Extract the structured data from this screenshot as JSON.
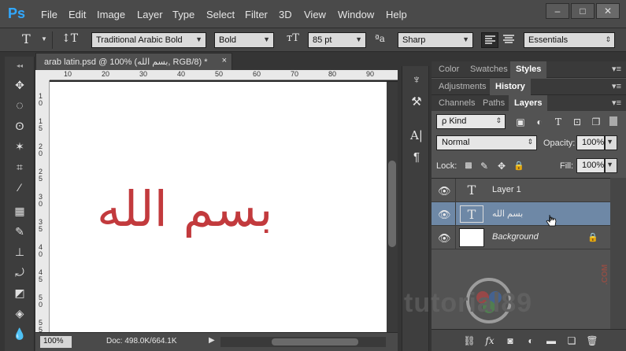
{
  "app": {
    "logo": "Ps"
  },
  "menu": [
    "File",
    "Edit",
    "Image",
    "Layer",
    "Type",
    "Select",
    "Filter",
    "3D",
    "View",
    "Window",
    "Help"
  ],
  "window_controls": {
    "minimize": "–",
    "maximize": "□",
    "close": "✕"
  },
  "options_bar": {
    "tool_glyph": "T",
    "orientation_glyph": "↕T",
    "font_family": "Traditional Arabic Bold",
    "font_style": "Bold",
    "size_glyph": "тT",
    "font_size": "85 pt",
    "aa_glyph": "ªa",
    "anti_alias": "Sharp",
    "workspace": "Essentials"
  },
  "document": {
    "tab_title": "arab latin.psd @ 100% (بسم الله, RGB/8) *",
    "tab_close": "×",
    "canvas_text": "بسم الله",
    "text_color": "#c23a3d",
    "ruler_top": [
      "10",
      "20",
      "30",
      "40",
      "50",
      "60",
      "70",
      "80",
      "90"
    ],
    "ruler_left": [
      "1\n0",
      "1\n5",
      "2\n0",
      "2\n5",
      "3\n0",
      "3\n5",
      "4\n0",
      "4\n5",
      "5\n0",
      "5\n5"
    ]
  },
  "status": {
    "zoom": "100%",
    "doc_info": "Doc: 498.0K/664.1K",
    "arrow": "▶"
  },
  "panels": {
    "row1_tabs": [
      "Color",
      "Swatches",
      "Styles"
    ],
    "row1_active": "Styles",
    "row2_tabs": [
      "Adjustments",
      "History"
    ],
    "row2_active": "History",
    "row3_tabs": [
      "Channels",
      "Paths",
      "Layers"
    ],
    "row3_active": "Layers",
    "menu_glyph": "▾≡",
    "filter_kind": "ρ Kind",
    "blend_mode": "Normal",
    "opacity_label": "Opacity:",
    "opacity_value": "100%",
    "lock_label": "Lock:",
    "fill_label": "Fill:",
    "fill_value": "100%"
  },
  "layers": [
    {
      "name": "Layer 1",
      "type": "text",
      "selected": false,
      "italic": false
    },
    {
      "name": "بسم الله",
      "type": "text",
      "selected": true,
      "italic": false
    },
    {
      "name": "Background",
      "type": "image",
      "selected": false,
      "italic": true,
      "locked": true
    }
  ],
  "watermark": {
    "text": "tutorial89",
    "dotcom": ".COM"
  },
  "colors": {
    "accent": "#31a8ff",
    "selection": "#6e88a6",
    "canvas_text": "#c23a3d"
  }
}
